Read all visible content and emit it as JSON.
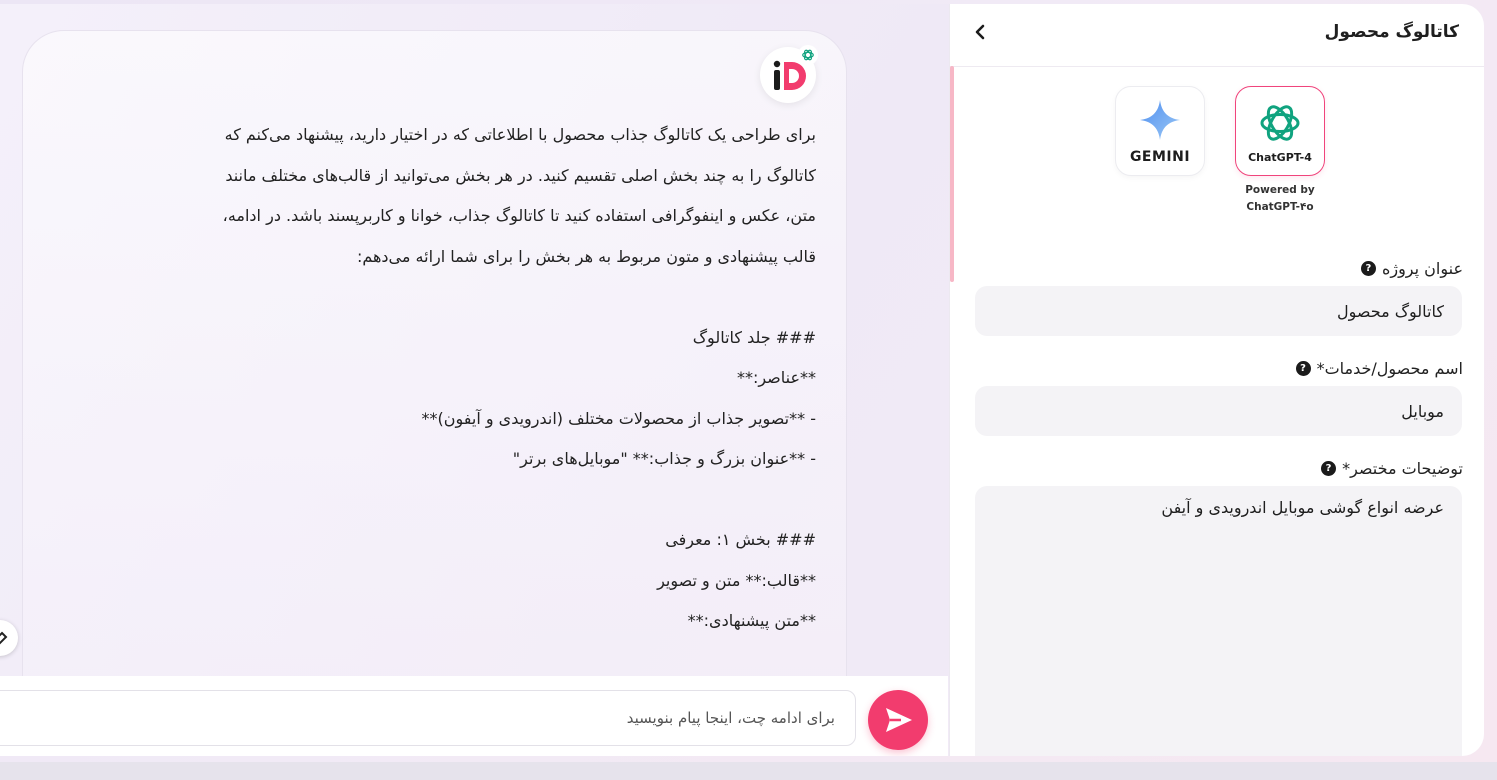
{
  "sidebar": {
    "title": "کاتالوگ محصول",
    "models": [
      {
        "label": "ChatGPT-4",
        "selected": true,
        "icon": "openai-icon"
      },
      {
        "label": "GEMINI",
        "selected": false,
        "icon": "gemini-star-icon"
      }
    ],
    "powered_line1": "Powered by",
    "powered_line2": "ChatGPT-۴o",
    "fields": {
      "project_title": {
        "label": "عنوان پروژه",
        "value": "کاتالوگ محصول"
      },
      "product_name": {
        "label": "اسم محصول/خدمات*",
        "value": "موبایل"
      },
      "description": {
        "label": "توضیحات مختصر*",
        "value": "عرضه انواع گوشی موبایل اندرویدی و آیفن"
      }
    }
  },
  "chat": {
    "lines": [
      "برای طراحی یک کاتالوگ جذاب محصول با اطلاعاتی که در اختیار دارید، پیشنهاد می‌کنم که",
      "کاتالوگ را به چند بخش اصلی تقسیم کنید. در هر بخش می‌توانید از قالب‌های مختلف مانند",
      "متن، عکس و اینفوگرافی استفاده کنید تا کاتالوگ جذاب، خوانا و کاربرپسند باشد. در ادامه،",
      "قالب پیشنهادی و متون مربوط به هر بخش را برای شما ارائه می‌دهم:",
      "",
      "### جلد کاتالوگ",
      "**عناصر:**",
      "- **تصویر جذاب از محصولات مختلف (اندرویدی و آیفون)**",
      "- **عنوان بزرگ و جذاب:** \"موبایل‌های برتر\"",
      "",
      "### بخش ۱: معرفی",
      "**قالب:** متن و تصویر",
      "**متن پیشنهادی:**"
    ],
    "composer_placeholder": "برای ادامه چت، اینجا پیام بنویسید"
  },
  "colors": {
    "accent": "#f23c6e",
    "selected_border": "#f0447c",
    "openai_green": "#10a37f"
  }
}
